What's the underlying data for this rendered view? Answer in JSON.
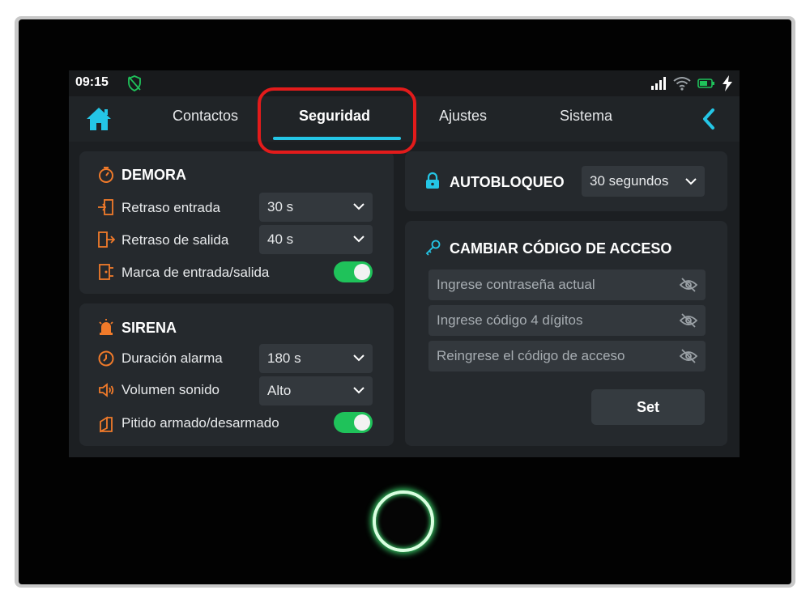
{
  "status_bar": {
    "time": "09:15"
  },
  "nav": {
    "tabs": [
      {
        "label": "Contactos"
      },
      {
        "label": "Seguridad",
        "active": true
      },
      {
        "label": "Ajustes"
      },
      {
        "label": "Sistema"
      }
    ]
  },
  "demora": {
    "title": "DEMORA",
    "rows": [
      {
        "label": "Retraso entrada",
        "value": "30 s"
      },
      {
        "label": "Retraso de salida",
        "value": "40 s"
      },
      {
        "label": "Marca de entrada/salida",
        "toggle_on": true
      }
    ]
  },
  "sirena": {
    "title": "SIRENA",
    "rows": [
      {
        "label": "Duración alarma",
        "value": "180 s"
      },
      {
        "label": "Volumen sonido",
        "value": "Alto"
      },
      {
        "label": "Pitido armado/desarmado",
        "toggle_on": true
      }
    ]
  },
  "autobloqueo": {
    "title": "AUTOBLOQUEO",
    "value": "30 segundos"
  },
  "access_code": {
    "title": "CAMBIAR CÓDIGO DE ACCESO",
    "placeholders": [
      "Ingrese contraseña actual",
      "Ingrese código 4 dígitos",
      "Reingrese el código de acceso"
    ],
    "set_label": "Set"
  },
  "colors": {
    "accent": "#24c6e6",
    "icon_orange": "#f07a2a",
    "toggle_green": "#1fc25a",
    "highlight_red": "#e31b1b",
    "panel_bg": "#25292d"
  }
}
